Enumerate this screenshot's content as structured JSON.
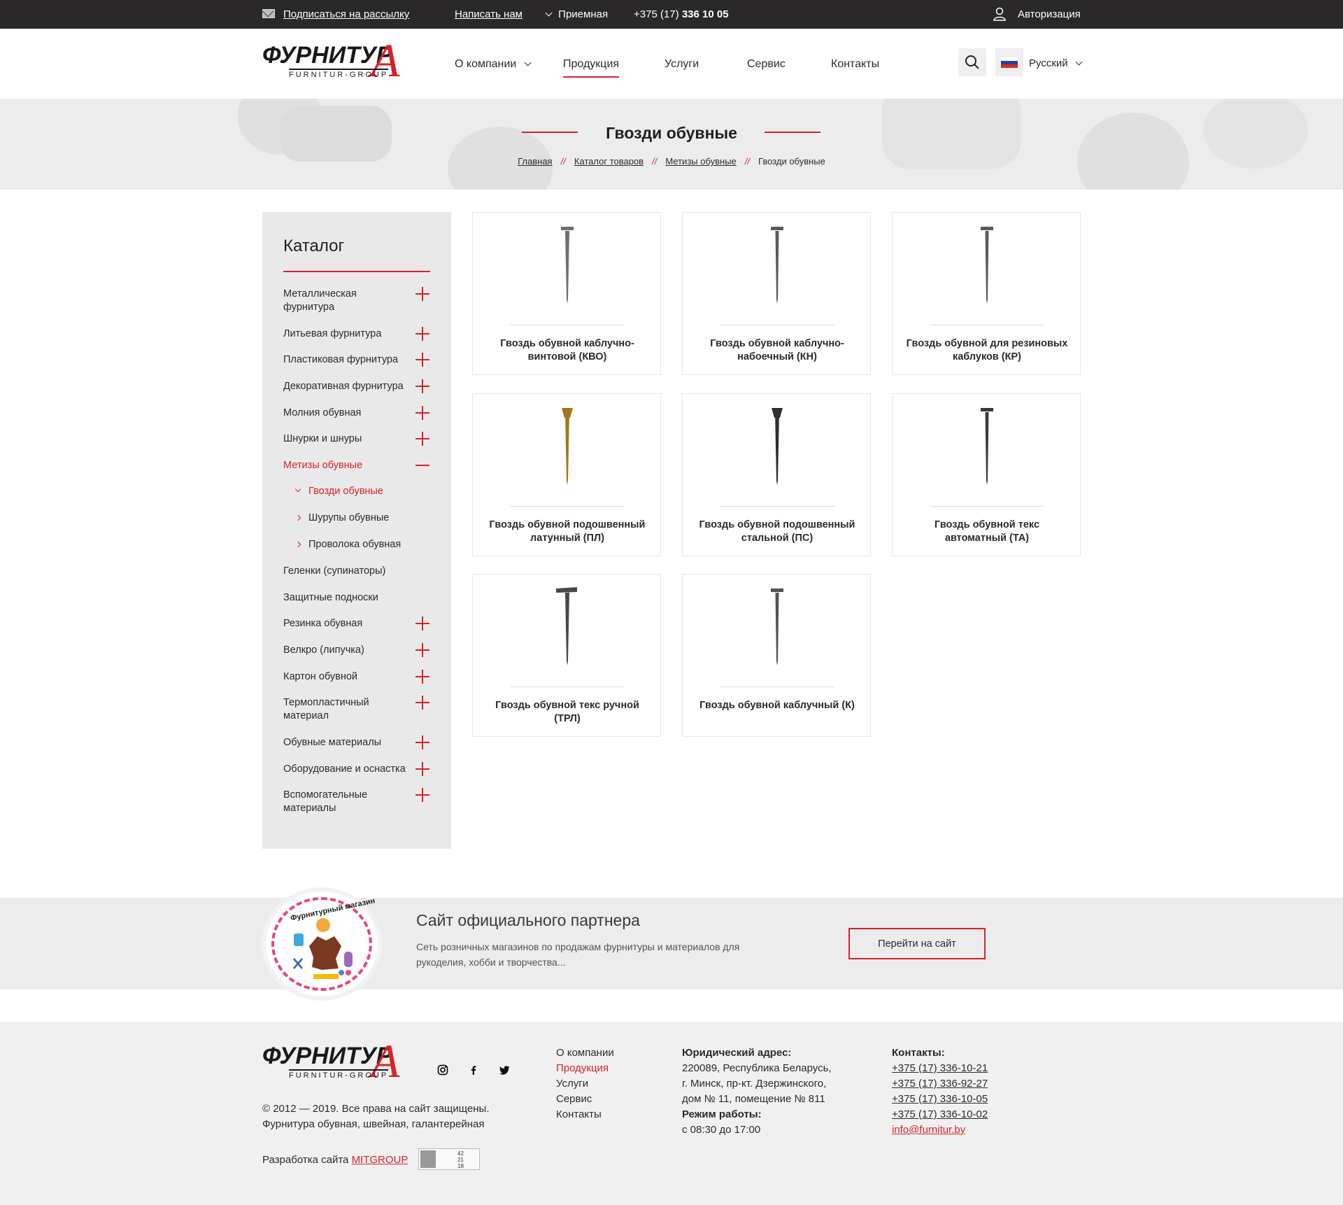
{
  "topbar": {
    "subscribe": "Подписаться на рассылку",
    "write_us": "Написать нам",
    "reception": "Приемная",
    "phone_prefix": "+375 (17)",
    "phone_number": "336 10 05",
    "auth": "Авторизация"
  },
  "header": {
    "logo_word": "ФУРНИТУР",
    "logo_letter": "А",
    "logo_sub": "FURNITUR-GROUP",
    "nav": [
      "О компании",
      "Продукция",
      "Услуги",
      "Сервис",
      "Контакты"
    ],
    "active_nav": "Продукция",
    "language": "Русский"
  },
  "hero": {
    "title": "Гвозди обувные",
    "breadcrumbs": [
      "Главная",
      "Каталог товаров",
      "Метизы обувные",
      "Гвозди обувные"
    ],
    "separator": "//"
  },
  "catalog": {
    "title": "Каталог",
    "items": [
      {
        "label": "Металлическая фурнитура",
        "toggle": "plus"
      },
      {
        "label": "Литьевая фурнитура",
        "toggle": "plus"
      },
      {
        "label": "Пластиковая фурнитура",
        "toggle": "plus"
      },
      {
        "label": "Декоративная фурнитура",
        "toggle": "plus"
      },
      {
        "label": "Молния обувная",
        "toggle": "plus"
      },
      {
        "label": "Шнурки и шнуры",
        "toggle": "plus"
      },
      {
        "label": "Метизы обувные",
        "toggle": "minus"
      },
      {
        "label": "Геленки (супинаторы)",
        "toggle": "none"
      },
      {
        "label": "Защитные подноски",
        "toggle": "none"
      },
      {
        "label": "Резинка обувная",
        "toggle": "plus"
      },
      {
        "label": "Велкро (липучка)",
        "toggle": "plus"
      },
      {
        "label": "Картон обувной",
        "toggle": "plus"
      },
      {
        "label": "Термопластичный материал",
        "toggle": "plus"
      },
      {
        "label": "Обувные материалы",
        "toggle": "plus"
      },
      {
        "label": "Оборудование и оснастка",
        "toggle": "plus"
      },
      {
        "label": "Вспомогательные материалы",
        "toggle": "plus"
      }
    ],
    "subitems": [
      "Гвозди обувные",
      "Шурупы обувные",
      "Проволока обувная"
    ],
    "active_subitem": "Гвозди обувные"
  },
  "products": [
    {
      "name": "Гвоздь обувной каблучно-винтовой (КВО)",
      "color": "#6f6f6f"
    },
    {
      "name": "Гвоздь обувной каблучно-набоечный (КН)",
      "color": "#5e5a55"
    },
    {
      "name": "Гвоздь обувной для резиновых каблуков (КР)",
      "color": "#5a5a5a"
    },
    {
      "name": "Гвоздь обувной подошвенный латунный (ПЛ)",
      "color": "#a5761f"
    },
    {
      "name": "Гвоздь обувной подошвенный стальной (ПС)",
      "color": "#2f2f2f"
    },
    {
      "name": "Гвоздь обувной текс автоматный (ТА)",
      "color": "#3a3a3a"
    },
    {
      "name": "Гвоздь обувной текс ручной (ТРЛ)",
      "color": "#4a4843"
    },
    {
      "name": "Гвоздь обувной каблучный (К)",
      "color": "#55524d"
    }
  ],
  "partner": {
    "logo_text": "Фурнитурный магазин",
    "title": "Сайт официального партнера",
    "text": "Сеть розничных магазинов по продажам фурнитуры и материалов для рукоделия, хобби и творчества...",
    "button": "Перейти на сайт"
  },
  "footer": {
    "copyright": "© 2012 — 2019. Все права на сайт защищены.",
    "tagline": "Фурнитура обувная, швейная,  галантерейная",
    "dev_prefix": "Разработка сайта",
    "dev_link": "MITGROUP",
    "menu": [
      "О компании",
      "Продукция",
      "Услуги",
      "Сервис",
      "Контакты"
    ],
    "active_menu": "Продукция",
    "address_title": "Юридический адрес:",
    "address_lines": [
      "220089, Республика Беларусь,",
      "г.  Минск, пр-кт. Дзержинского,",
      "дом № 11,  помещение № 811"
    ],
    "hours_title": "Режим работы:",
    "hours": "с 08:30 до 17:00",
    "contacts_title": "Контакты:",
    "phones": [
      "+375 (17) 336-10-21",
      "+375 (17) 336-92-27",
      "+375 (17) 336-10-05",
      "+375 (17) 336-10-02"
    ],
    "email": "info@furnitur.by",
    "counter": [
      "42",
      "21",
      "18"
    ],
    "accent": "#d5232a"
  }
}
